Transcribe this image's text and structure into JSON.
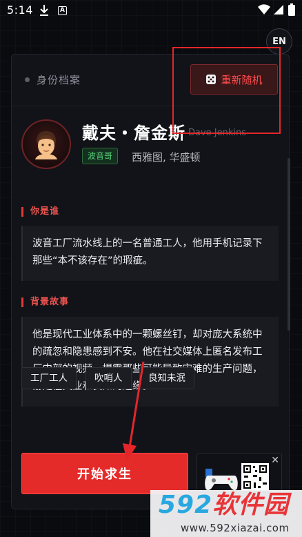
{
  "status_bar": {
    "time": "5:14",
    "download_icon": "download-icon",
    "text_icon": "A"
  },
  "language_button": "EN",
  "header": {
    "label": "身份档案",
    "reroll_label": "重新随机",
    "reroll_icon": "dice-icon"
  },
  "profile": {
    "avatar_icon": "man-face-icon",
    "name_cn": "戴夫・詹金斯",
    "name_en": "Dave Jenkins",
    "tag": "波音哥",
    "location": "西雅图, 华盛顿"
  },
  "who": {
    "title": "你是谁",
    "text": "波音工厂流水线上的一名普通工人，他用手机记录下那些“本不该存在”的瑕疵。"
  },
  "background": {
    "title": "背景故事",
    "text": "他是现代工业体系中的一颗螺丝钉，却对庞大系统中的疏忽和隐患感到不安。他在社交媒体上匿名发布工厂内部的视频，揭露那些可能导致灾难的生产问题，游走在失业和良知的边缘。"
  },
  "traits": [
    "工厂工人",
    "吹哨人",
    "良知未泯"
  ],
  "start_button": "开始求生",
  "ad": {
    "close": "✕"
  },
  "watermark": {
    "logo_num": "592",
    "logo_cn": "软件园",
    "url": "www.592xiazai.com"
  },
  "colors": {
    "accent": "#e52a2a",
    "tag_green": "#58d07a",
    "background": "#0a0b0f",
    "card": "#121318"
  }
}
